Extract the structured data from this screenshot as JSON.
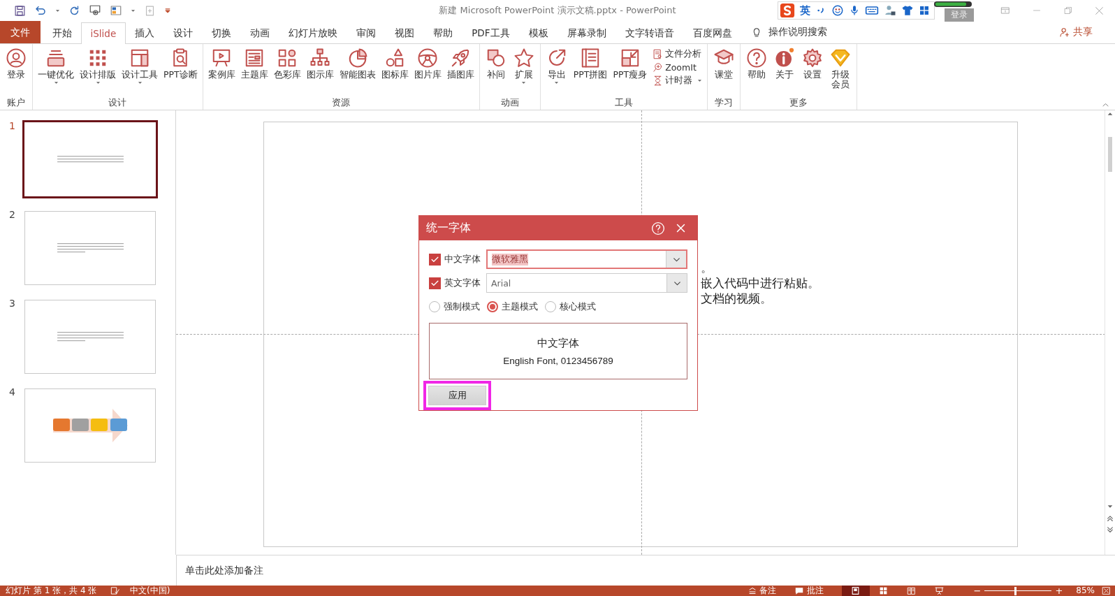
{
  "window": {
    "title": "新建 Microsoft PowerPoint 演示文稿.pptx  -  PowerPoint"
  },
  "ime_bar": {
    "mode": "英",
    "login_button": "登录"
  },
  "tabs": [
    {
      "label": "文件",
      "kind": "file",
      "selected": false
    },
    {
      "label": "开始",
      "kind": "tab",
      "selected": false
    },
    {
      "label": "iSlide",
      "kind": "tab",
      "selected": true
    },
    {
      "label": "插入",
      "kind": "tab",
      "selected": false
    },
    {
      "label": "设计",
      "kind": "tab",
      "selected": false
    },
    {
      "label": "切换",
      "kind": "tab",
      "selected": false
    },
    {
      "label": "动画",
      "kind": "tab",
      "selected": false
    },
    {
      "label": "幻灯片放映",
      "kind": "tab",
      "selected": false
    },
    {
      "label": "审阅",
      "kind": "tab",
      "selected": false
    },
    {
      "label": "视图",
      "kind": "tab",
      "selected": false
    },
    {
      "label": "帮助",
      "kind": "tab",
      "selected": false
    },
    {
      "label": "PDF工具",
      "kind": "tab",
      "selected": false
    },
    {
      "label": "模板",
      "kind": "tab",
      "selected": false
    },
    {
      "label": "屏幕录制",
      "kind": "tab",
      "selected": false
    },
    {
      "label": "文字转语音",
      "kind": "tab",
      "selected": false
    },
    {
      "label": "百度网盘",
      "kind": "tab",
      "selected": false
    }
  ],
  "tell_me": "操作说明搜索",
  "share": "共享",
  "ribbon": {
    "groups": [
      {
        "label": "账户",
        "buttons": [
          {
            "label": "登录",
            "kind": "large",
            "dropdown": false
          }
        ]
      },
      {
        "label": "设计",
        "buttons": [
          {
            "label": "一键优化",
            "kind": "large",
            "dropdown": true
          },
          {
            "label": "设计排版",
            "kind": "large",
            "dropdown": true
          },
          {
            "label": "设计工具",
            "kind": "large",
            "dropdown": true
          },
          {
            "label": "PPT诊断",
            "kind": "large",
            "dropdown": false
          }
        ]
      },
      {
        "label": "资源",
        "buttons": [
          {
            "label": "案例库",
            "kind": "large",
            "dropdown": false
          },
          {
            "label": "主题库",
            "kind": "large",
            "dropdown": false
          },
          {
            "label": "色彩库",
            "kind": "large",
            "dropdown": false
          },
          {
            "label": "图示库",
            "kind": "large",
            "dropdown": false
          },
          {
            "label": "智能图表",
            "kind": "large",
            "dropdown": false
          },
          {
            "label": "图标库",
            "kind": "large",
            "dropdown": false
          },
          {
            "label": "图片库",
            "kind": "large",
            "dropdown": false
          },
          {
            "label": "插图库",
            "kind": "large",
            "dropdown": false
          }
        ]
      },
      {
        "label": "动画",
        "buttons": [
          {
            "label": "补间",
            "kind": "large",
            "dropdown": false
          },
          {
            "label": "扩展",
            "kind": "large",
            "dropdown": true
          }
        ]
      },
      {
        "label": "工具",
        "buttons": [
          {
            "label": "导出",
            "kind": "large",
            "dropdown": true
          },
          {
            "label": "PPT拼图",
            "kind": "large",
            "dropdown": false
          },
          {
            "label": "PPT瘦身",
            "kind": "large",
            "dropdown": false
          },
          {
            "label": "文件分析",
            "kind": "small",
            "dropdown": false
          },
          {
            "label": "ZoomIt",
            "kind": "small",
            "dropdown": false
          },
          {
            "label": "计时器",
            "kind": "small",
            "dropdown": true
          }
        ]
      },
      {
        "label": "学习",
        "buttons": [
          {
            "label": "课堂",
            "kind": "large",
            "dropdown": false
          }
        ]
      },
      {
        "label": "更多",
        "buttons": [
          {
            "label": "帮助",
            "kind": "large",
            "dropdown": false
          },
          {
            "label": "关于",
            "kind": "large",
            "dropdown": false
          },
          {
            "label": "设置",
            "kind": "large",
            "dropdown": false
          },
          {
            "label": "升级会员",
            "kind": "tall",
            "dropdown": false
          }
        ]
      }
    ]
  },
  "slides": [
    {
      "number": "1",
      "selected": true,
      "kind": "text"
    },
    {
      "number": "2",
      "selected": false,
      "kind": "text"
    },
    {
      "number": "3",
      "selected": false,
      "kind": "text"
    },
    {
      "number": "4",
      "selected": false,
      "kind": "diagram"
    }
  ],
  "slide": {
    "text_lines": [
      "。",
      "嵌入代码中进行粘贴。",
      "文档的视频。"
    ]
  },
  "dialog": {
    "title": "统一字体",
    "fields": [
      {
        "label": "中文字体",
        "checked": true,
        "value": "微软雅黑",
        "focused": true
      },
      {
        "label": "英文字体",
        "checked": true,
        "value": "Arial",
        "focused": false
      }
    ],
    "modes": [
      {
        "label": "强制模式",
        "selected": false
      },
      {
        "label": "主题模式",
        "selected": true
      },
      {
        "label": "核心模式",
        "selected": false
      }
    ],
    "preview": {
      "chinese": "中文字体",
      "english": "English Font, 0123456789"
    },
    "apply_button": "应用",
    "apply_highlighted": true
  },
  "notes": {
    "prompt": "单击此处添加备注"
  },
  "status_bar": {
    "slide_info": "幻灯片 第 1 张，共 4 张",
    "language": "中文(中国)",
    "notes_button": "备注",
    "comments_button": "批注",
    "views": [
      {
        "kind": "normal",
        "selected": true
      },
      {
        "kind": "sorter",
        "selected": false
      },
      {
        "kind": "reading",
        "selected": false
      },
      {
        "kind": "slideshow",
        "selected": false
      }
    ],
    "zoom": {
      "minus": "−",
      "plus": "+",
      "level": 0.45,
      "reading": "85%"
    }
  }
}
